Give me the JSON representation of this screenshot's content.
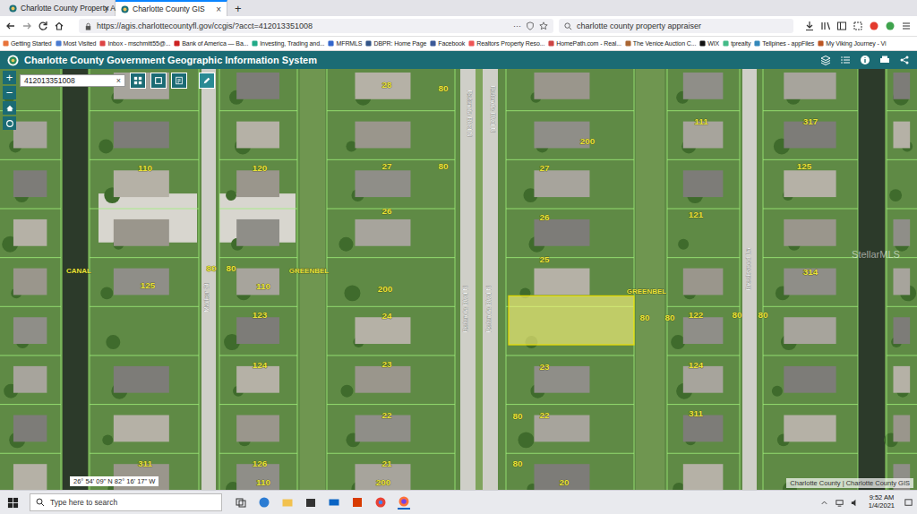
{
  "browser": {
    "tabs": [
      {
        "label": "Charlotte County Property App",
        "selected": false
      },
      {
        "label": "Charlotte County GIS",
        "selected": true
      }
    ],
    "tab_close": "×",
    "new_tab": "+",
    "address": "https://agis.charlottecountyfl.gov/ccgis/?acct=412013351008",
    "page_menu": "···",
    "search": "charlotte county property appraiser",
    "bookmarks": [
      "Getting Started",
      "Most Visited",
      "Inbox - mschmitt55@...",
      "Bank of America — Ba...",
      "Investing, Trading and...",
      "MFRMLS",
      "DBPR: Home Page",
      "Facebook",
      "Realtors Property Reso...",
      "HomePath.com - Real...",
      "The Venice Auction C...",
      "WIX",
      "tprealty",
      "Tellpines - appFiles",
      "My Viking Journey - Vi"
    ]
  },
  "app": {
    "title": "Charlotte County Government Geographic Information System",
    "search_value": "412013351008",
    "clear": "×"
  },
  "map": {
    "zoom_in": "+",
    "zoom_out": "−",
    "coordinates": "26° 54' 09\" N 82° 16' 17\" W",
    "attribution": "Charlotte County | Charlotte County GIS",
    "watermark": "StellarMLS",
    "labels": [
      "CANAL",
      "GREENBEL",
      "GREENBEL",
      "Marker St",
      "Rotonda Blvd N",
      "Rotonda Blvd N",
      "Rotonda Blvd N",
      "Rotonda Blvd N",
      "Brookwood Ln",
      "200",
      "200",
      "200",
      "125",
      "125",
      "110",
      "110",
      "111",
      "317",
      "314",
      "311",
      "311",
      "28",
      "27",
      "26",
      "24",
      "23",
      "22",
      "21",
      "27",
      "26",
      "25",
      "23",
      "22",
      "20",
      "120",
      "123",
      "124",
      "126",
      "110",
      "121",
      "122",
      "124",
      "80",
      "80",
      "80",
      "80",
      "80",
      "80",
      "80",
      "80",
      "80",
      "80"
    ]
  },
  "taskbar": {
    "search_placeholder": "Type here to search",
    "time": "9:52 AM",
    "date": "1/4/2021"
  }
}
